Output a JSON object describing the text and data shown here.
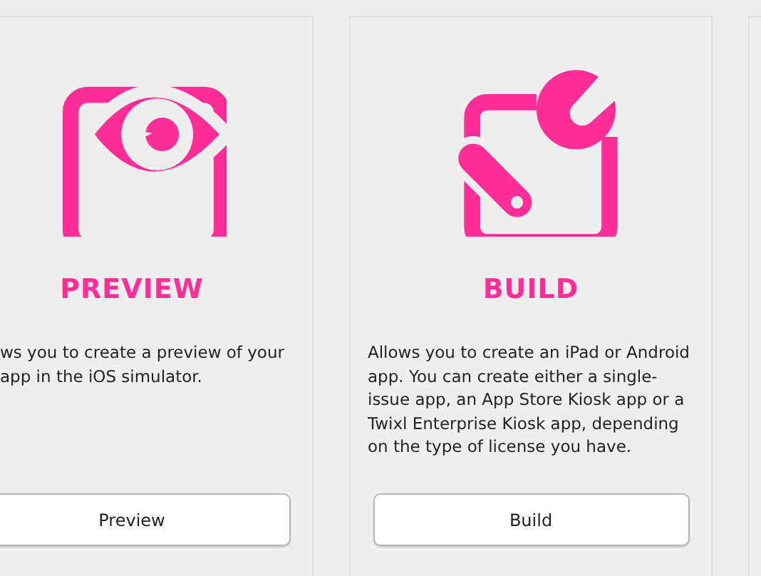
{
  "cards": [
    {
      "kind": "preview",
      "title": "PREVIEW",
      "description": "ws you to create a preview of your app in the iOS simulator.",
      "button": "Preview"
    },
    {
      "kind": "build",
      "title": "BUILD",
      "description": "Allows you to create an iPad or Android app. You can create either a single-issue app, an App Store Kiosk app or a Twixl Enterprise Kiosk app, depending on the type of license you have.",
      "button": "Build"
    }
  ]
}
